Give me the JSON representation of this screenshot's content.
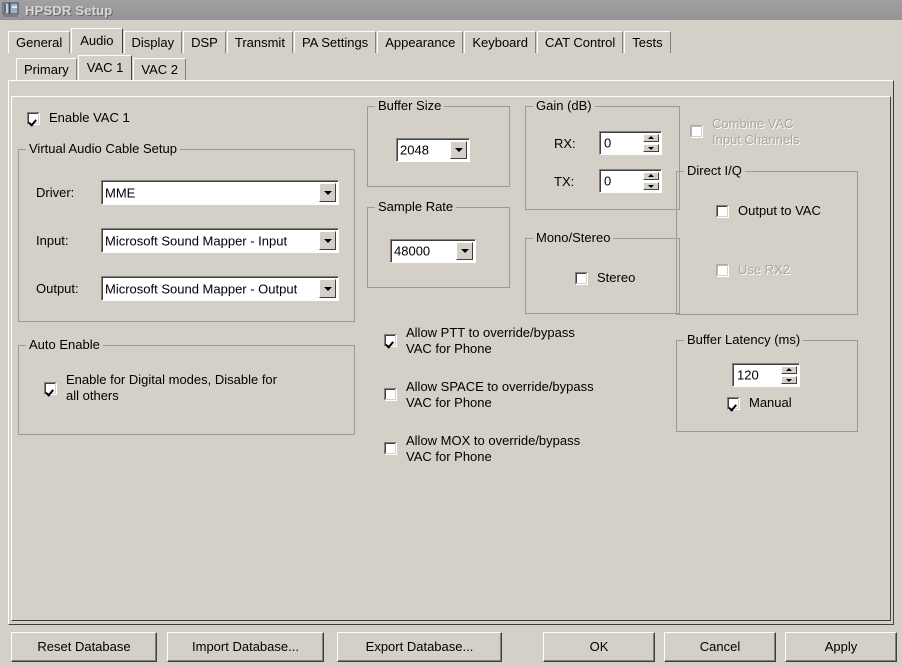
{
  "window": {
    "title": "HPSDR Setup",
    "icon": "hpsdr-app-icon"
  },
  "tabs_primary": [
    {
      "label": "General",
      "selected": false
    },
    {
      "label": "Audio",
      "selected": true
    },
    {
      "label": "Display",
      "selected": false
    },
    {
      "label": "DSP",
      "selected": false
    },
    {
      "label": "Transmit",
      "selected": false
    },
    {
      "label": "PA Settings",
      "selected": false
    },
    {
      "label": "Appearance",
      "selected": false
    },
    {
      "label": "Keyboard",
      "selected": false
    },
    {
      "label": "CAT Control",
      "selected": false
    },
    {
      "label": "Tests",
      "selected": false
    }
  ],
  "tabs_secondary": [
    {
      "label": "Primary",
      "selected": false
    },
    {
      "label": "VAC 1",
      "selected": true
    },
    {
      "label": "VAC 2",
      "selected": false
    }
  ],
  "enable_vac": {
    "label": "Enable VAC 1",
    "checked": true
  },
  "vac_setup": {
    "title": "Virtual Audio Cable Setup",
    "driver_label": "Driver:",
    "driver_value": "MME",
    "input_label": "Input:",
    "input_value": "Microsoft Sound Mapper - Input",
    "output_label": "Output:",
    "output_value": "Microsoft Sound Mapper - Output"
  },
  "auto_enable": {
    "title": "Auto Enable",
    "checkbox_label": "Enable for Digital modes, Disable for\nall others",
    "checked": true
  },
  "buffer_size": {
    "title": "Buffer Size",
    "value": "2048"
  },
  "sample_rate": {
    "title": "Sample Rate",
    "value": "48000"
  },
  "gain": {
    "title": "Gain (dB)",
    "rx_label": "RX:",
    "rx_value": "0",
    "tx_label": "TX:",
    "tx_value": "0"
  },
  "mono_stereo": {
    "title": "Mono/Stereo",
    "stereo_label": "Stereo",
    "stereo_checked": false
  },
  "combine_vac": {
    "label": "Combine VAC\nInput Channels",
    "checked": false,
    "disabled": true
  },
  "direct_iq": {
    "title": "Direct I/Q",
    "output_to_vac_label": "Output to VAC",
    "output_to_vac_checked": false,
    "use_rx2_label": "Use RX2",
    "use_rx2_checked": false,
    "use_rx2_disabled": true
  },
  "buffer_latency": {
    "title": "Buffer Latency (ms)",
    "value": "120",
    "manual_label": "Manual",
    "manual_checked": true
  },
  "override_options": [
    {
      "label": "Allow PTT to override/bypass\nVAC for Phone",
      "checked": true
    },
    {
      "label": "Allow SPACE to override/bypass\nVAC for Phone",
      "checked": false
    },
    {
      "label": "Allow MOX to override/bypass\nVAC for Phone",
      "checked": false
    }
  ],
  "footer_buttons": [
    {
      "label": "Reset Database"
    },
    {
      "label": "Import Database..."
    },
    {
      "label": "Export Database..."
    },
    {
      "label": "OK"
    },
    {
      "label": "Cancel"
    },
    {
      "label": "Apply"
    }
  ],
  "colors": {
    "face": "#d4d0c8",
    "titlebar": "#9a9a9c",
    "title_text": "#d8d8d8",
    "group_border": "#9d9a92",
    "disabled_text": "#a8a49c"
  }
}
